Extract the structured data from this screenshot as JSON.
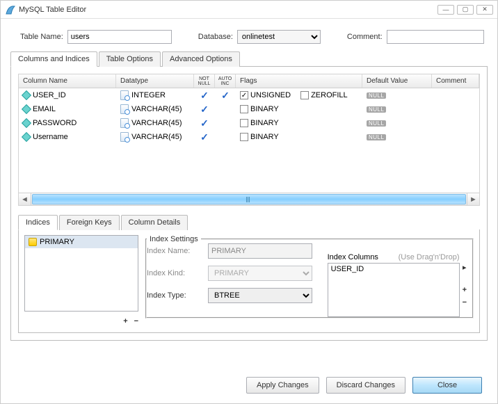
{
  "window": {
    "title": "MySQL Table Editor"
  },
  "top": {
    "table_name_label": "Table Name:",
    "table_name": "users",
    "database_label": "Database:",
    "database": "onlinetest",
    "comment_label": "Comment:",
    "comment": ""
  },
  "tabs": {
    "columns": "Columns and Indices",
    "table_options": "Table Options",
    "advanced": "Advanced Options"
  },
  "grid": {
    "headers": {
      "name": "Column Name",
      "datatype": "Datatype",
      "notnull": "NOT NULL",
      "autoinc": "AUTO INC",
      "flags": "Flags",
      "default": "Default Value",
      "comment": "Comment"
    },
    "flag_unsigned": "UNSIGNED",
    "flag_zerofill": "ZEROFILL",
    "flag_binary": "BINARY",
    "null_badge": "NULL",
    "rows": [
      {
        "name": "USER_ID",
        "datatype": "INTEGER",
        "notnull": true,
        "autoinc": true,
        "flags": [
          {
            "label": "UNSIGNED",
            "checked": true
          },
          {
            "label": "ZEROFILL",
            "checked": false
          }
        ],
        "def": "NULL"
      },
      {
        "name": "EMAIL",
        "datatype": "VARCHAR(45)",
        "notnull": true,
        "autoinc": false,
        "flags": [
          {
            "label": "BINARY",
            "checked": false
          }
        ],
        "def": "NULL"
      },
      {
        "name": "PASSWORD",
        "datatype": "VARCHAR(45)",
        "notnull": true,
        "autoinc": false,
        "flags": [
          {
            "label": "BINARY",
            "checked": false
          }
        ],
        "def": "NULL"
      },
      {
        "name": "Username",
        "datatype": "VARCHAR(45)",
        "notnull": true,
        "autoinc": false,
        "flags": [
          {
            "label": "BINARY",
            "checked": false
          }
        ],
        "def": "NULL"
      }
    ]
  },
  "subtabs": {
    "indices": "Indices",
    "fk": "Foreign Keys",
    "details": "Column Details"
  },
  "indices": {
    "list": [
      "PRIMARY"
    ],
    "settings_legend": "Index Settings",
    "name_label": "Index Name:",
    "name_value": "PRIMARY",
    "kind_label": "Index Kind:",
    "kind_value": "PRIMARY",
    "type_label": "Index Type:",
    "type_value": "BTREE",
    "cols_label": "Index Columns",
    "cols_hint": "(Use Drag'n'Drop)",
    "cols": [
      "USER_ID"
    ]
  },
  "footer": {
    "apply": "Apply Changes",
    "discard": "Discard Changes",
    "close": "Close"
  }
}
